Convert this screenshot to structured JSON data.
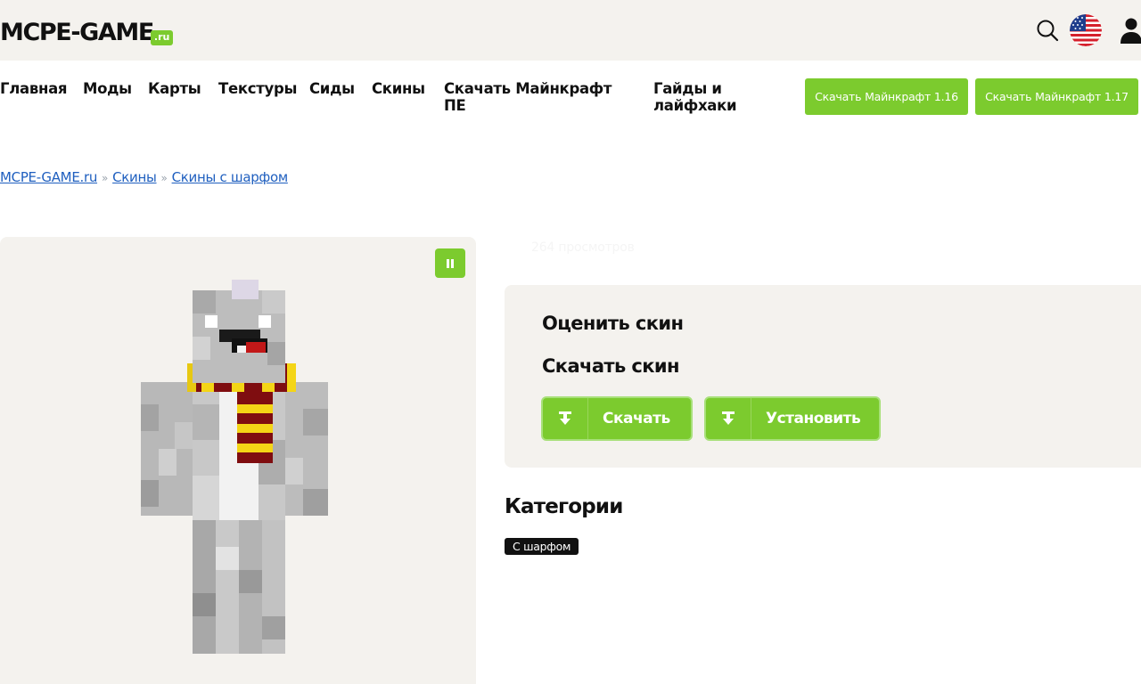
{
  "header": {
    "logo_text": "MCPE-GAME",
    "logo_badge": ".ru"
  },
  "nav": {
    "items": [
      {
        "label": "Главная"
      },
      {
        "label": "Моды"
      },
      {
        "label": "Карты"
      },
      {
        "label": "Текстуры"
      },
      {
        "label": "Сиды"
      },
      {
        "label": "Скины"
      },
      {
        "label": "Скачать Майнкрафт ПЕ"
      },
      {
        "label": "Гайды и лайфхаки"
      }
    ],
    "buttons": [
      {
        "label": "Скачать Майнкрафт 1.16"
      },
      {
        "label": "Скачать Майнкрафт 1.17"
      }
    ]
  },
  "breadcrumb": {
    "items": [
      "MCPE-GAME.ru",
      "Скины",
      "Скины с шарфом"
    ],
    "separator": "»"
  },
  "stats": {
    "views": "264 просмотров"
  },
  "panel": {
    "rate_title": "Оценить скин",
    "download_title": "Скачать скин",
    "download_label": "Скачать",
    "install_label": "Установить"
  },
  "categories": {
    "title": "Категории",
    "tags": [
      "С шарфом"
    ]
  },
  "colors": {
    "accent": "#7ccb2e",
    "header_bg": "#f4f2ee",
    "link": "#1f5fbf",
    "tag_bg": "#111111"
  },
  "icons": [
    "search-icon",
    "us-flag-icon",
    "user-icon",
    "pause-icon",
    "download-icon"
  ]
}
